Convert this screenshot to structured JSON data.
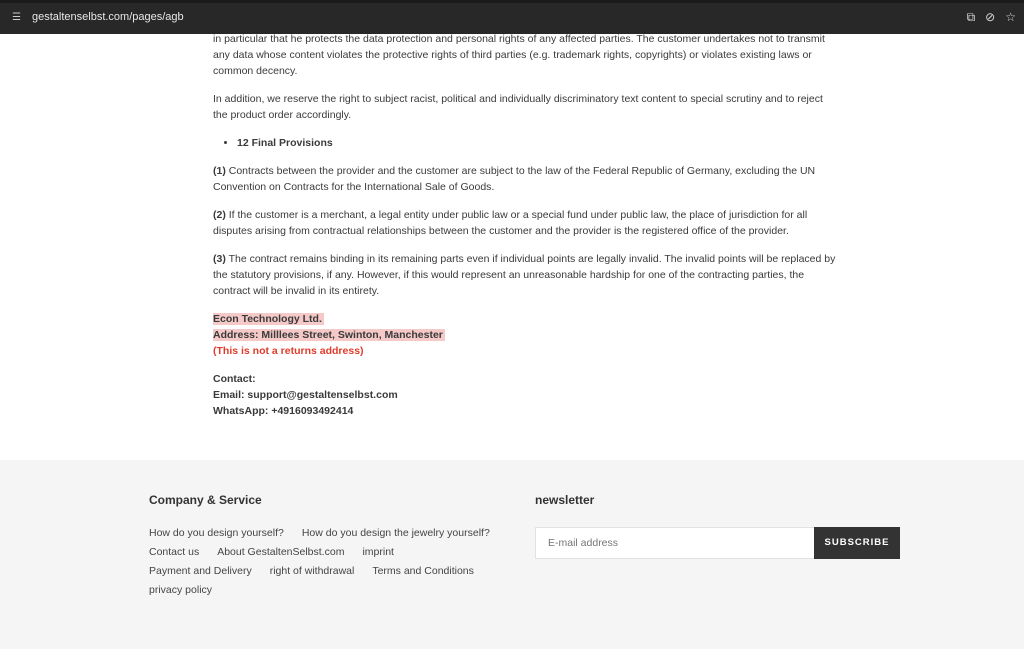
{
  "browser": {
    "url": "gestaltenselbst.com/pages/agb",
    "icons": [
      "site-info-icon",
      "translate-icon",
      "eye-off-icon",
      "star-icon"
    ]
  },
  "content": {
    "p1": "in particular that he protects the data protection and personal rights of any affected parties. The customer undertakes not to transmit any data whose content violates the protective rights of third parties (e.g. trademark rights, copyrights) or violates existing laws or common decency.",
    "p2": "In addition, we reserve the right to subject racist, political and individually discriminatory text content to special scrutiny and to reject the product order accordingly.",
    "heading": "12 Final Provisions",
    "items": [
      {
        "num": "(1)",
        "text": " Contracts between the provider and the customer are subject to the law of the Federal Republic of Germany, excluding the UN Convention on Contracts for the International Sale of Goods."
      },
      {
        "num": "(2)",
        "text": " If the customer is a merchant, a legal entity under public law or a special fund under public law, the place of jurisdiction for all disputes arising from contractual relationships between the customer and the provider is the registered office of the provider."
      },
      {
        "num": "(3)",
        "text": " The contract remains binding in its remaining parts even if individual points are legally invalid. The invalid points will be replaced by the statutory provisions, if any. However, if this would represent an unreasonable hardship for one of the contracting parties, the contract will be invalid in its entirety."
      }
    ],
    "company": "Econ Technology Ltd.",
    "address": "Address: Milllees Street, Swinton, Manchester",
    "note": "(This is not a returns address)",
    "contact": "Contact:",
    "email": "Email: support@gestaltenselbst.com",
    "whatsapp": "WhatsApp: +4916093492414"
  },
  "footer": {
    "company_heading": "Company & Service",
    "links": [
      [
        "How do you design yourself?",
        "How do you design the jewelry yourself?"
      ],
      [
        "Contact us",
        "About GestaltenSelbst.com",
        "imprint"
      ],
      [
        "Payment and Delivery",
        "right of withdrawal",
        "Terms and Conditions"
      ],
      [
        "privacy policy"
      ]
    ],
    "newsletter_heading": "newsletter",
    "email_placeholder": "E-mail address",
    "subscribe": "SUBSCRIBE"
  }
}
